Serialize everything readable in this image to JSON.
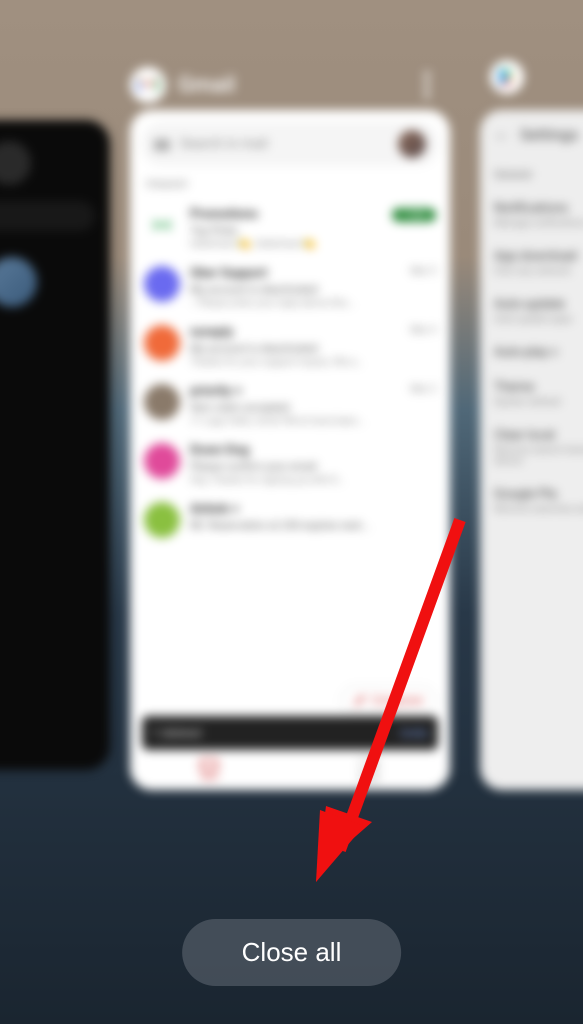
{
  "center_app": {
    "title": "Gmail",
    "search_placeholder": "Search in mail",
    "section": "PRIMARY",
    "compose": "Compose",
    "snackbar_text": "1 deleted",
    "snackbar_action": "Undo",
    "nav_mail": "Mail",
    "nav_meet": "Meet",
    "promo_label": "Promotions",
    "promo_badge": "1 new",
    "promo_sender": "Top Picks",
    "promo_preview": "Hellofresh 🍋, Hellofresh 🍋",
    "mails": [
      {
        "sender": "Uber Support",
        "sub": "My account is deactivated",
        "preview": "-- Please enter your reply above this...",
        "date": "Mar 5",
        "color": "#6a6af0"
      },
      {
        "sender": "noreply",
        "sub": "My account is deactivated",
        "preview": "Thanks for your support inquiry. We a...",
        "date": "Mar 4",
        "color": "#f06a3a"
      },
      {
        "sender": "priority +",
        "sub": "Item claim accepted",
        "preview": "+1 Lego Hello, Anne! We've have been...",
        "date": "Mar 2",
        "color": "#8a7a6a"
      },
      {
        "sender": "Down Dog",
        "sub": "Please confirm your email",
        "preview": "Hey, Thanks for signing up with D...",
        "date": "",
        "color": "#e04a9a"
      },
      {
        "sender": "Airbnb +",
        "sub": "RE: Reservation at 230 expires next...",
        "preview": "",
        "date": "",
        "color": "#8ac040"
      }
    ]
  },
  "right_app": {
    "title": "Settings",
    "section": "General",
    "items": [
      {
        "t": "Notifications",
        "s": "Manage notifications"
      },
      {
        "t": "App download",
        "s": "Over any network"
      },
      {
        "t": "Auto-update",
        "s": "Auto-update apps"
      },
      {
        "t": "Auto-play v",
        "s": ""
      },
      {
        "t": "Theme",
        "s": "System default"
      },
      {
        "t": "Clear local",
        "s": "Remove search history from this device"
      },
      {
        "t": "Google Pla",
        "s": "Remove searches and other activity"
      }
    ]
  },
  "close_all": "Close all"
}
